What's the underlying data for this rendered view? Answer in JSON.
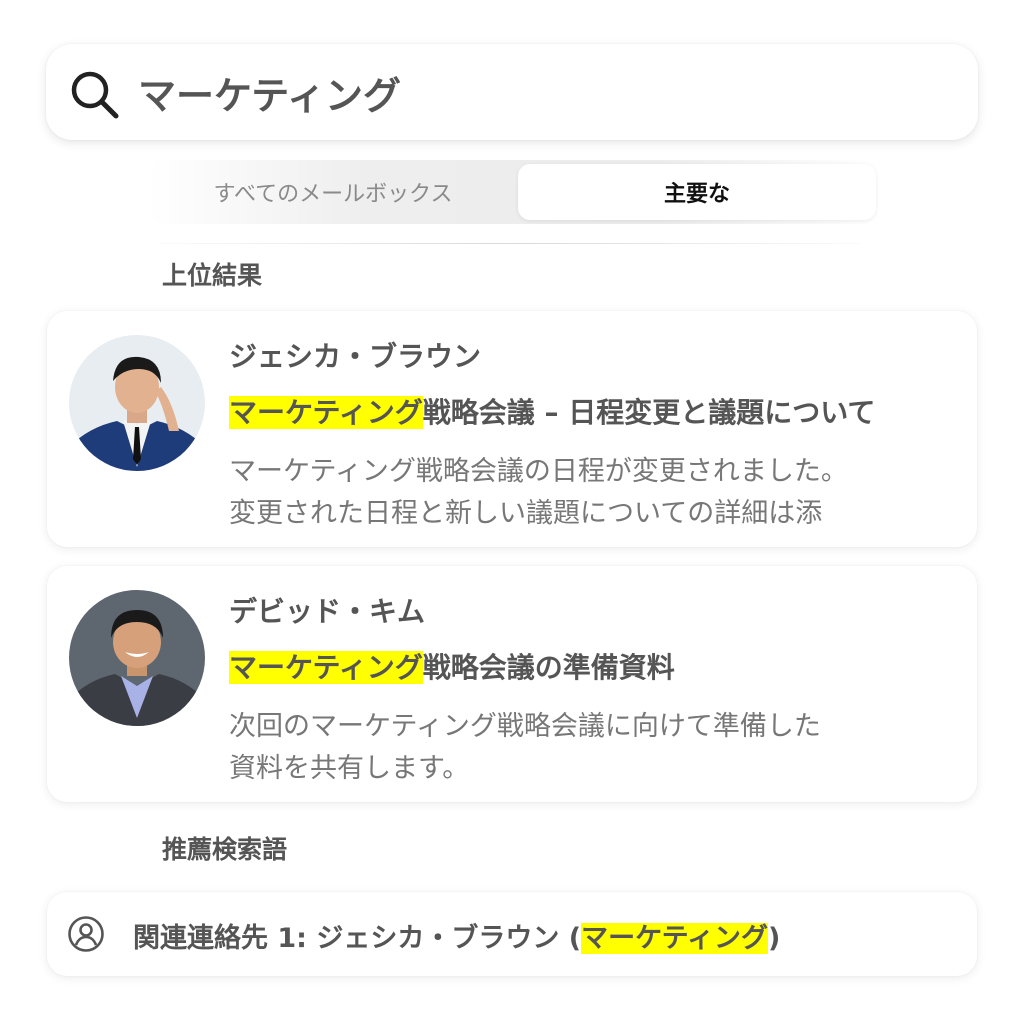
{
  "search": {
    "query": "マーケティング",
    "icon": "search-icon"
  },
  "scope_tabs": {
    "all_mailboxes": "すべてのメールボックス",
    "primary": "主要な",
    "selected": "primary"
  },
  "sections": {
    "top_results": "上位結果",
    "suggested_searches": "推薦検索語"
  },
  "results": [
    {
      "sender": "ジェシカ・ブラウン",
      "subject_highlight": "マーケティング",
      "subject_rest": "戦略会議 – 日程変更と議題について",
      "snippet_line1": "マーケティング戦略会議の日程が変更されました。",
      "snippet_line2": "変更された日程と新しい議題についての詳細は添"
    },
    {
      "sender": "デビッド・キム",
      "subject_highlight": "マーケティング",
      "subject_rest": "戦略会議の準備資料",
      "snippet_line1": "次回のマーケティング戦略会議に向けて準備した",
      "snippet_line2": "資料を共有します。"
    }
  ],
  "suggestion": {
    "prefix": "関連連絡先 1: ジェシカ・ブラウン (",
    "highlight": "マーケティング",
    "suffix": ")",
    "icon": "person-circle-icon"
  },
  "colors": {
    "highlight": "#ffff00",
    "text": "#555555",
    "snippet": "#777777"
  }
}
